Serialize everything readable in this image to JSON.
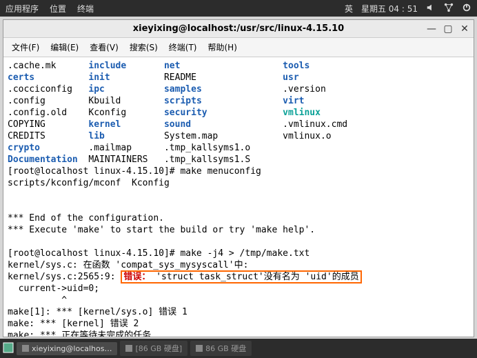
{
  "topbar": {
    "apps": "应用程序",
    "places": "位置",
    "terminal": "终端",
    "ime": "英",
    "clock": "星期五 04 : 51"
  },
  "window": {
    "title": "xieyixing@localhost:/usr/src/linux-4.15.10"
  },
  "menubar": {
    "file": "文件(F)",
    "edit": "编辑(E)",
    "view": "查看(V)",
    "search": "搜索(S)",
    "terminal": "终端(T)",
    "help": "帮助(H)"
  },
  "ls": {
    "col1": [
      ".cache.mk",
      "certs",
      ".cocciconfig",
      ".config",
      ".config.old",
      "COPYING",
      "CREDITS",
      "crypto",
      "Documentation"
    ],
    "col2": [
      "include",
      "init",
      "ipc",
      "Kbuild",
      "Kconfig",
      "kernel",
      "lib",
      ".mailmap",
      "MAINTAINERS"
    ],
    "col3": [
      "net",
      "README",
      "samples",
      "scripts",
      "security",
      "sound",
      "System.map",
      ".tmp_kallsyms1.o",
      ".tmp_kallsyms1.S"
    ],
    "col4": [
      "tools",
      "usr",
      ".version",
      "virt",
      "vmlinux",
      ".vmlinux.cmd",
      "vmlinux.o",
      "",
      ""
    ],
    "col1_blue": [
      false,
      true,
      false,
      false,
      false,
      false,
      false,
      true,
      true
    ],
    "col2_blue": [
      true,
      true,
      true,
      false,
      false,
      true,
      true,
      false,
      false
    ],
    "col3_blue": [
      true,
      false,
      true,
      true,
      true,
      true,
      false,
      false,
      false
    ],
    "col4_blue": [
      true,
      true,
      false,
      true,
      false,
      false,
      false,
      false,
      false
    ],
    "col4_cyan": [
      false,
      false,
      false,
      false,
      true,
      false,
      false,
      false,
      false
    ]
  },
  "term": {
    "prompt1": "[root@localhost linux-4.15.10]# make menuconfig",
    "line_mconf": "scripts/kconfig/mconf  Kconfig",
    "endconf1": "*** End of the configuration.",
    "endconf2": "*** Execute 'make' to start the build or try 'make help'.",
    "prompt2": "[root@localhost linux-4.15.10]# make -j4 > /tmp/make.txt",
    "err_loc": "kernel/sys.c: 在函数 'compat_sys_mysyscall'中:",
    "err_pre": "kernel/sys.c:2565:9: ",
    "err_label": "错误： ",
    "err_mid": "'struct task_struct'",
    "err_post": "没有名为 'uid'的成员",
    "err_src": "  current->uid=0;",
    "err_caret": "          ^",
    "make1": "make[1]: *** [kernel/sys.o] 错误 1",
    "make2": "make: *** [kernel] 错误 2",
    "make3": "make: *** 正在等待未完成的任务...."
  },
  "taskbar": {
    "term_task": "xieyixing@localhos…",
    "disk1": "[86 GB 硬盘]",
    "disk2": "86 GB 硬盘"
  }
}
